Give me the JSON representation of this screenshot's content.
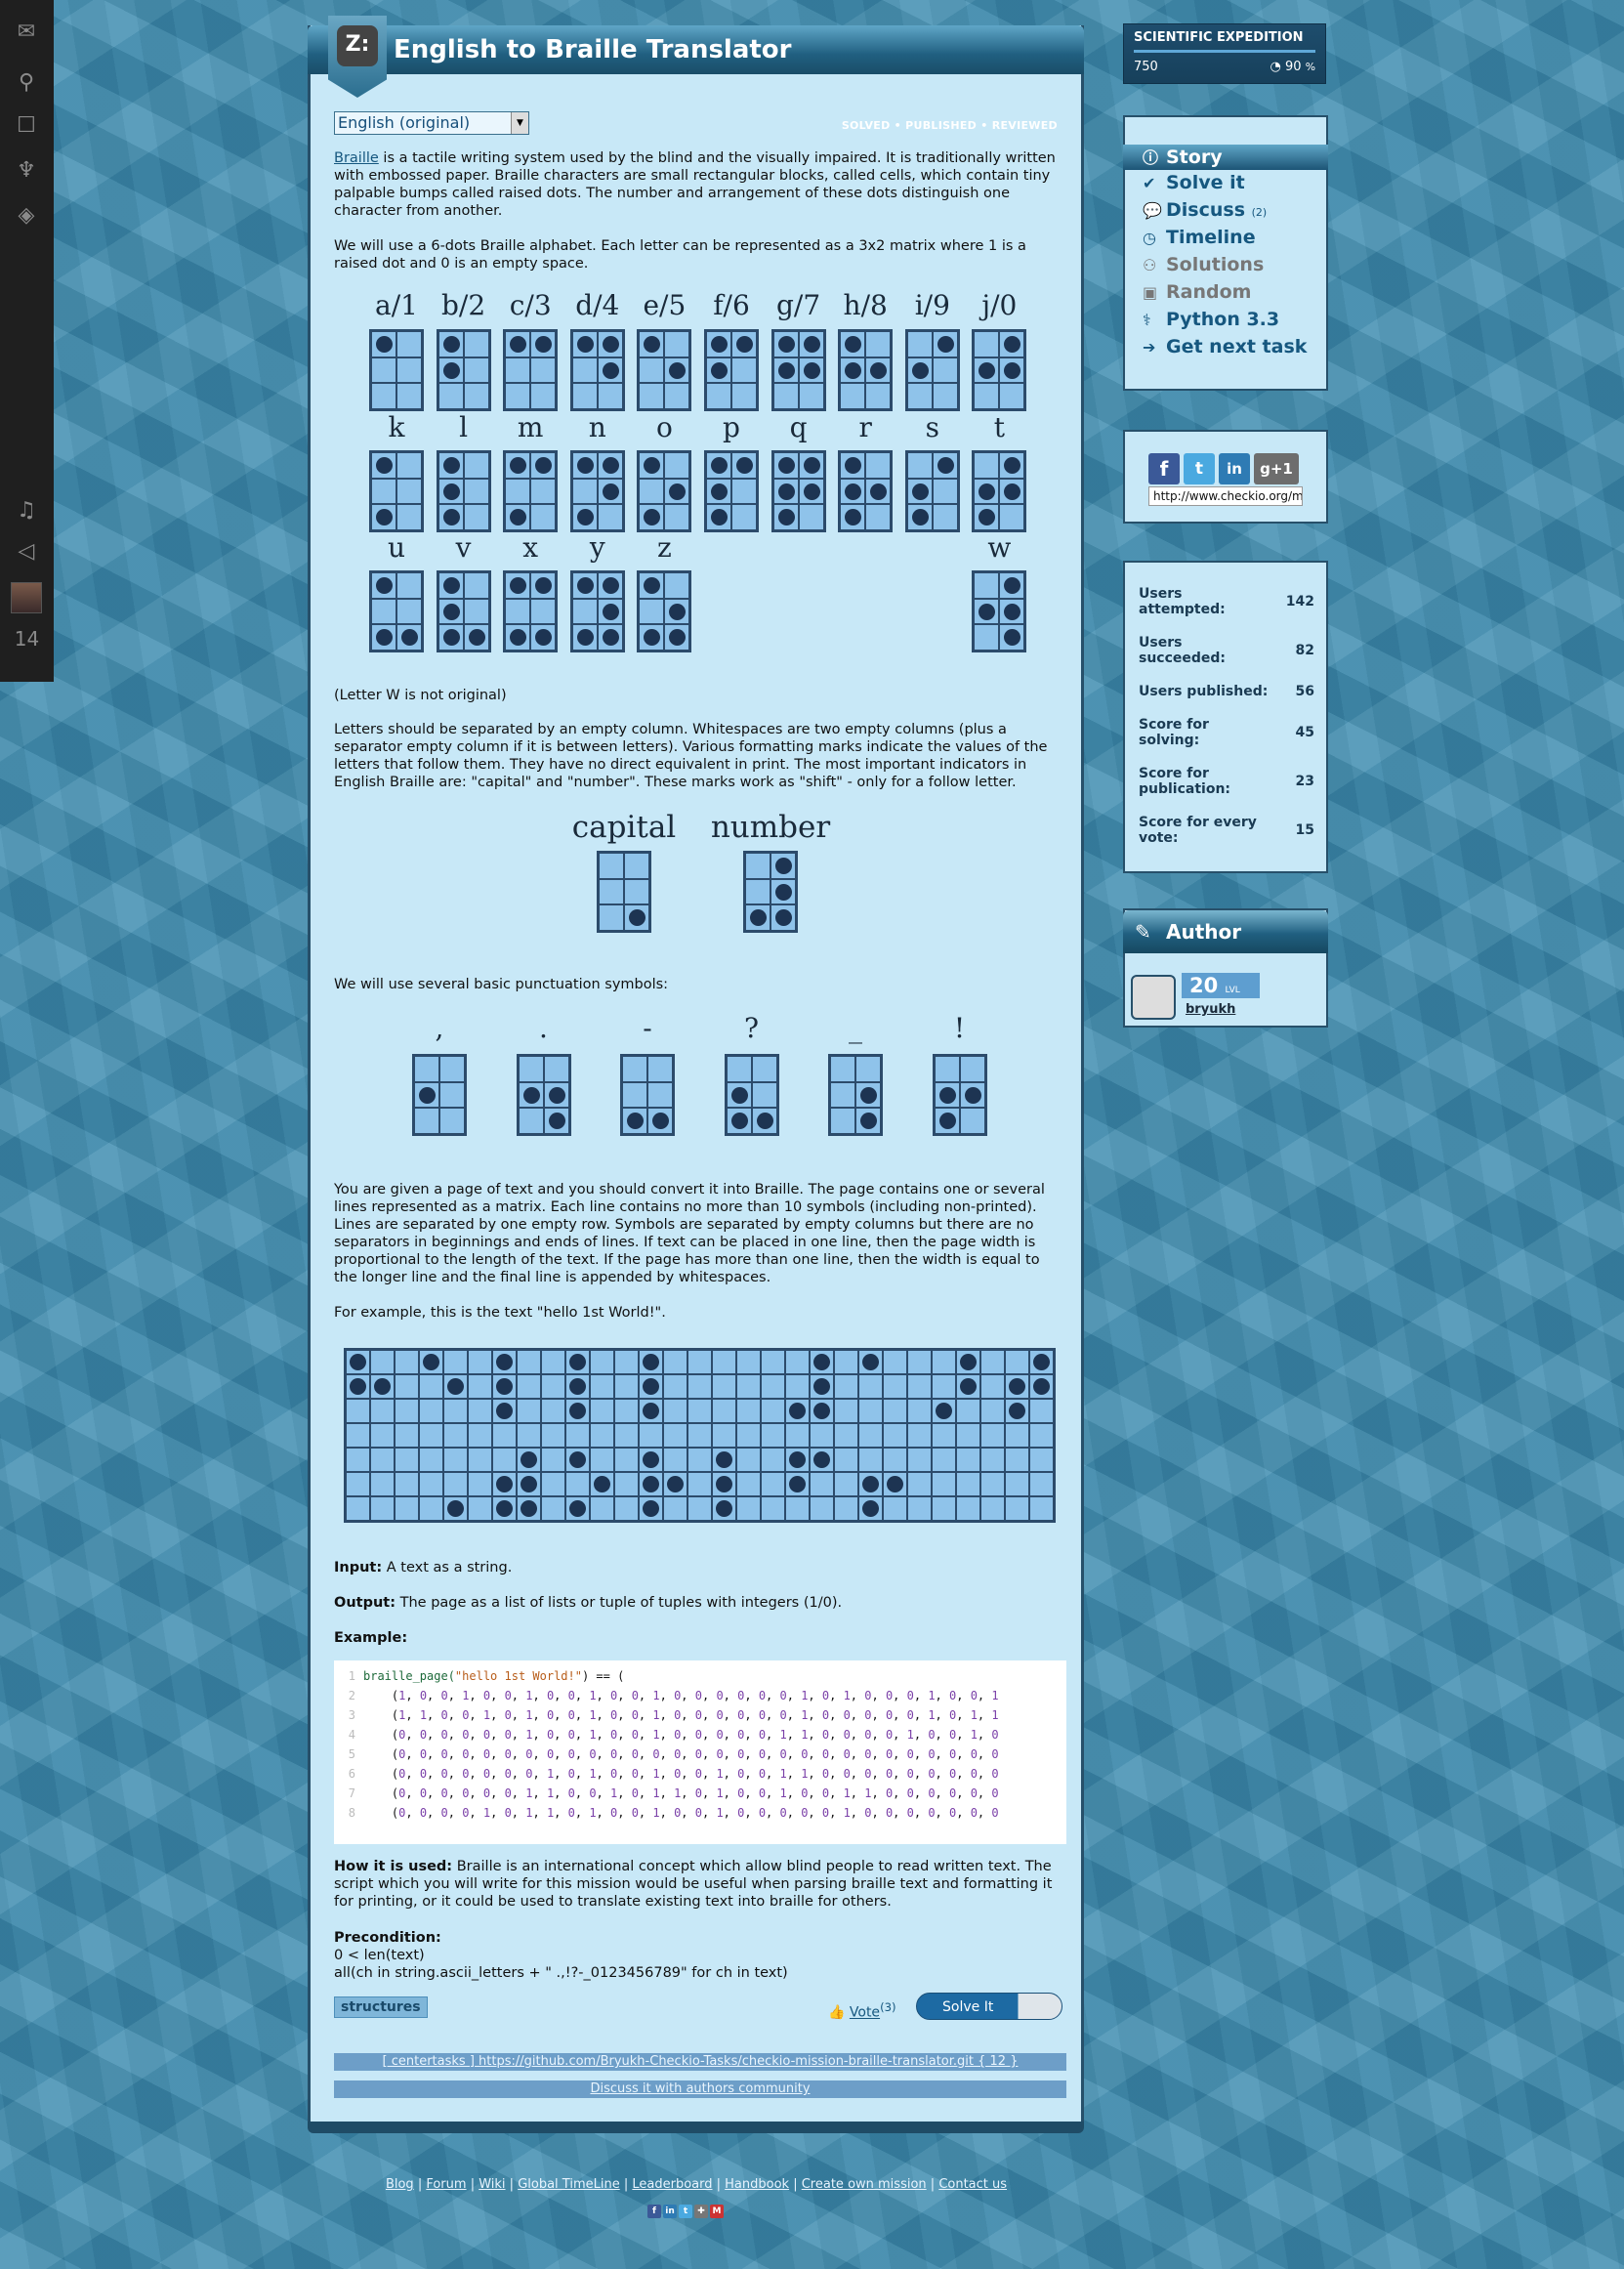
{
  "sidebar": {
    "icons": [
      "envelope-icon",
      "network-icon",
      "chat-icon",
      "trophy-icon",
      "map-icon",
      "bell-icon",
      "megaphone-icon"
    ],
    "count": "14"
  },
  "main": {
    "title": "English to Braille Translator",
    "language": "English (original)",
    "status": [
      "SOLVED",
      "PUBLISHED",
      "REVIEWED"
    ],
    "intro_link": "Braille",
    "intro_rest": " is a tactile writing system used by the blind and the visually impaired. It is traditionally written with embossed paper. Braille characters are small rectangular blocks, called cells, which contain tiny palpable bumps called raised dots. The number and arrangement of these dots distinguish one character from another.",
    "p2": "We will use a 6-dots Braille alphabet. Each letter can be represented as a 3x2 matrix where 1 is a raised dot and 0 is an empty space.",
    "letters_row1": [
      "a/1",
      "b/2",
      "c/3",
      "d/4",
      "e/5",
      "f/6",
      "g/7",
      "h/8",
      "i/9",
      "j/0"
    ],
    "letters_row2": [
      "k",
      "l",
      "m",
      "n",
      "o",
      "p",
      "q",
      "r",
      "s",
      "t"
    ],
    "letters_row3": [
      "u",
      "v",
      "x",
      "y",
      "z",
      "w"
    ],
    "note_w": "(Letter W is not original)",
    "p3": "Letters should be separated by an empty column. Whitespaces are two empty columns (plus a separator empty column if it is between letters). Various formatting marks indicate the values of the letters that follow them. They have no direct equivalent in print. The most important indicators in English Braille are: \"capital\" and \"number\". These marks work as \"shift\" - only for a follow letter.",
    "marks": [
      "capital",
      "number"
    ],
    "p4": "We will use several basic punctuation symbols:",
    "punct": [
      ",",
      ".",
      "-",
      "?",
      "_",
      "!"
    ],
    "p5": "You are given a page of text and you should convert it into Braille. The page contains one or several lines represented as a matrix. Each line contains no more than 10 symbols (including non-printed). Lines are separated by one empty row. Symbols are separated by empty columns but there are no separators in beginnings and ends of lines. If text can be placed in one line, then the page width is proportional to the length of the text. If the page has more than one line, then the width is equal to the longer line and the final line is appended by whitespaces.",
    "p6": "For example, this is the text \"hello 1st World!\".",
    "input_label": "Input:",
    "input_text": " A text as a string.",
    "output_label": "Output:",
    "output_text": " The page as a list of lists or tuple of tuples with integers (1/0).",
    "example_label": "Example:",
    "code_lines": [
      "braille_page(\"hello 1st World!\") == (",
      "    (1, 0, 0, 1, 0, 0, 1, 0, 0, 1, 0, 0, 1, 0, 0, 0, 0, 0, 0, 1, 0, 1, 0, 0, 0, 1, 0, 0, 1",
      "    (1, 1, 0, 0, 1, 0, 1, 0, 0, 1, 0, 0, 1, 0, 0, 0, 0, 0, 0, 1, 0, 0, 0, 0, 0, 1, 0, 1, 1",
      "    (0, 0, 0, 0, 0, 0, 1, 0, 0, 1, 0, 0, 1, 0, 0, 0, 0, 0, 1, 1, 0, 0, 0, 0, 1, 0, 0, 1, 0",
      "    (0, 0, 0, 0, 0, 0, 0, 0, 0, 0, 0, 0, 0, 0, 0, 0, 0, 0, 0, 0, 0, 0, 0, 0, 0, 0, 0, 0, 0",
      "    (0, 0, 0, 0, 0, 0, 0, 1, 0, 1, 0, 0, 1, 0, 0, 1, 0, 0, 1, 1, 0, 0, 0, 0, 0, 0, 0, 0, 0",
      "    (0, 0, 0, 0, 0, 0, 1, 1, 0, 0, 1, 0, 1, 1, 0, 1, 0, 0, 1, 0, 0, 1, 1, 0, 0, 0, 0, 0, 0",
      "    (0, 0, 0, 0, 1, 0, 1, 1, 0, 1, 0, 0, 1, 0, 0, 1, 0, 0, 0, 0, 0, 1, 0, 0, 0, 0, 0, 0, 0"
    ],
    "usage_label": "How it is used:",
    "usage_text": " Braille is an international concept which allow blind people to read written text. The script which you will write for this mission would be useful when parsing braille text and formatting it for printing, or it could be used to translate existing text into braille for others.",
    "precondition_label": "Precondition:",
    "precondition_1": "0 < len(text)",
    "precondition_2": "all(ch in string.ascii_letters + \" .,!?-_0123456789\" for ch in text)",
    "tag": "structures",
    "vote_label": "Vote",
    "vote_count": "(3)",
    "solve_label": "Solve It",
    "repo_text": "[ centertasks ] https://github.com/Bryukh-Checkio-Tasks/checkio-mission-braille-translator.git { 12 }",
    "discuss_text": "Discuss it with authors community"
  },
  "expedition": {
    "title": "SCIENTIFIC EXPEDITION",
    "score": "750",
    "percent": "90",
    "percent_unit": "%"
  },
  "nav": {
    "items": [
      {
        "label": "Story",
        "icon": "info-icon"
      },
      {
        "label": "Solve it",
        "icon": "check-icon"
      },
      {
        "label": "Discuss",
        "icon": "speech-icon",
        "count": "(2)"
      },
      {
        "label": "Timeline",
        "icon": "clock-icon"
      },
      {
        "label": "Solutions",
        "icon": "people-icon"
      },
      {
        "label": "Random",
        "icon": "box-icon"
      },
      {
        "label": "Python 3.3",
        "icon": "python-icon"
      },
      {
        "label": "Get next task",
        "icon": "arrow-icon"
      }
    ]
  },
  "share": {
    "url": "http://www.checkio.org/mission/braille-translator/",
    "buttons": [
      "f",
      "t",
      "in",
      "g+1"
    ]
  },
  "stats": [
    {
      "label": "Users attempted:",
      "value": "142"
    },
    {
      "label": "Users succeeded:",
      "value": "82"
    },
    {
      "label": "Users published:",
      "value": "56"
    },
    {
      "label": "Score for solving:",
      "value": "45"
    },
    {
      "label": "Score for publication:",
      "value": "23"
    },
    {
      "label": "Score for every vote:",
      "value": "15"
    }
  ],
  "author": {
    "heading": "Author",
    "level": "20",
    "level_unit": "LVL",
    "name": "bryukh"
  },
  "footer": {
    "links": [
      "Blog",
      "Forum",
      "Wiki",
      "Global TimeLine",
      "Leaderboard",
      "Handbook",
      "Create own mission",
      "Contact us"
    ]
  },
  "colors": {
    "page_bg": "#3d8db0",
    "card_bg": "#c8e8f7",
    "accent": "#16577f",
    "braille_fill": "#8fc3ea",
    "dot": "#1d3452"
  }
}
